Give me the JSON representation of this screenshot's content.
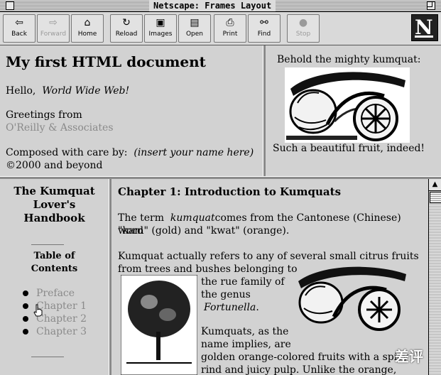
{
  "window": {
    "title": "Netscape: Frames Layout"
  },
  "toolbar": {
    "back": "Back",
    "forward": "Forward",
    "home": "Home",
    "reload": "Reload",
    "images": "Images",
    "open": "Open",
    "print": "Print",
    "find": "Find",
    "stop": "Stop"
  },
  "icons": {
    "back": "back-arrow-icon",
    "forward": "forward-arrow-icon",
    "home": "home-icon",
    "reload": "reload-icon",
    "images": "images-icon",
    "open": "open-icon",
    "print": "print-icon",
    "find": "find-icon",
    "stop": "stop-icon",
    "logo": "netscape-logo"
  },
  "logo": {
    "letter": "N"
  },
  "top_left": {
    "heading": "My first HTML document",
    "hello": "Hello,",
    "hello_emph": "World Wide Web!",
    "greetings": "Greetings from",
    "greetings_link": "O'Reilly & Associates",
    "composed": "Composed with care by:",
    "composed_emph": "(insert your name here)",
    "copyright": "©2000 and beyond"
  },
  "top_right": {
    "caption_top": "Behold the mighty kumquat:",
    "caption_bottom": "Such a beautiful fruit, indeed!"
  },
  "toc": {
    "title_line1": "The Kumquat",
    "title_line2": "Lover's",
    "title_line3": "Handbook",
    "sub_line1": "Table of",
    "sub_line2": "Contents",
    "items": [
      {
        "label": "Preface"
      },
      {
        "label": "Chapter 1"
      },
      {
        "label": "Chapter 2"
      },
      {
        "label": "Chapter 3"
      }
    ]
  },
  "chapter": {
    "heading": "Chapter 1: Introduction to Kumquats",
    "p1_a": "The term",
    "p1_emph": "kumquat",
    "p1_b": "comes from the Cantonese (Chinese) word",
    "p1_c": "\"kam\" (gold) and \"kwat\" (orange).",
    "p2_a": "Kumquat actually refers to any of several small citrus fruits",
    "p2_b": "from trees and bushes belonging to",
    "p2_c": "the rue family of",
    "p2_d": "the genus",
    "p2_emph": "Fortunella",
    "p2_e": ".",
    "p3_a": "Kumquats, as the",
    "p3_b": "name implies, are",
    "p3_c": "golden orange-colored fruits with a spicy",
    "p3_d": "rind and juicy pulp. Unlike the orange,"
  },
  "watermark": "差评",
  "colors": {
    "background": "#d2d2d2",
    "link_visited": "#8a8a8a",
    "divider": "#8a8a8a"
  }
}
